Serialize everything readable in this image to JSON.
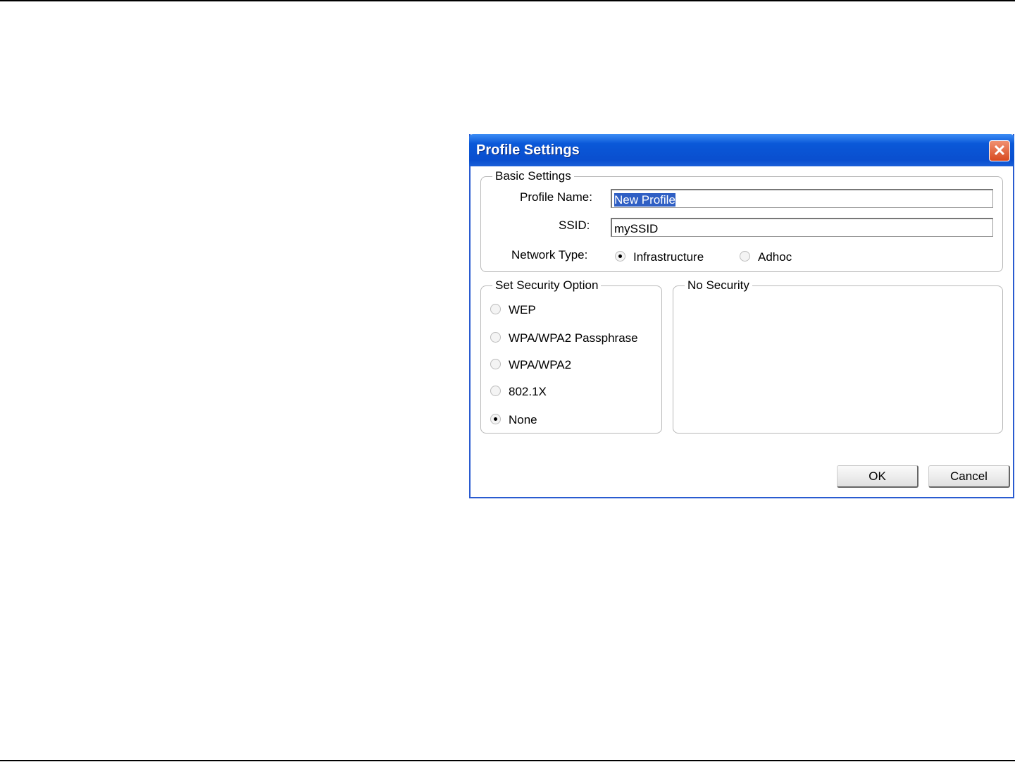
{
  "dialog": {
    "title": "Profile Settings",
    "close": "✕"
  },
  "basic": {
    "legend": "Basic Settings",
    "profile_label": "Profile Name:",
    "profile_value": "New Profile",
    "ssid_label": "SSID:",
    "ssid_value": "mySSID",
    "network_label": "Network Type:",
    "network_options": [
      {
        "label": "Infrastructure",
        "selected": true
      },
      {
        "label": "Adhoc",
        "selected": false
      }
    ]
  },
  "security": {
    "legend": "Set Security Option",
    "options": [
      {
        "label": "WEP",
        "selected": false
      },
      {
        "label": "WPA/WPA2 Passphrase",
        "selected": false
      },
      {
        "label": "WPA/WPA2",
        "selected": false
      },
      {
        "label": "802.1X",
        "selected": false
      },
      {
        "label": "None",
        "selected": true
      }
    ]
  },
  "detail": {
    "legend": "No Security"
  },
  "buttons": {
    "ok": "OK",
    "cancel": "Cancel"
  }
}
